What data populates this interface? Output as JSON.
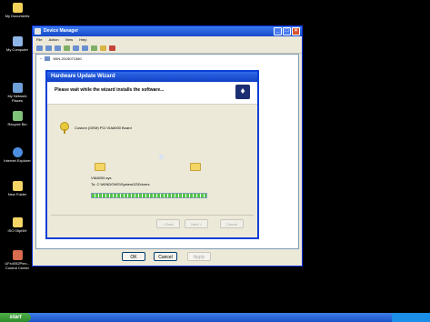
{
  "desktop": {
    "icons": [
      {
        "label": "My Documents",
        "icon": "my-documents-icon",
        "top": 0,
        "color": "#f2d25b"
      },
      {
        "label": "My Computer",
        "icon": "my-computer-icon",
        "top": 0,
        "color": "#8fb4e6"
      },
      {
        "label": "My Network Places",
        "icon": "network-places-icon",
        "top": 0,
        "color": "#6fa0d8"
      },
      {
        "label": "Recycle Bin",
        "icon": "recycle-bin-icon",
        "top": 0,
        "color": "#7fc37a"
      },
      {
        "label": "Internet Explorer",
        "icon": "internet-explorer-icon",
        "top": 0,
        "color": "#4d8fe0"
      },
      {
        "label": "New Folder",
        "icon": "folder-icon",
        "top": 0,
        "color": "#f4d565"
      },
      {
        "label": "ISO 05pf4H",
        "icon": "folder-icon",
        "top": 0,
        "color": "#f4d565"
      },
      {
        "label": "UFx4052Plex... Control Center",
        "icon": "control-center-icon",
        "top": 0,
        "color": "#d96b4f"
      }
    ]
  },
  "device_manager": {
    "title": "Device Manager",
    "menu": [
      "File",
      "Action",
      "View",
      "Help"
    ],
    "tree_root": "WIN-2015071360",
    "buttons": {
      "ok": "OK",
      "cancel": "Cancel",
      "apply": "Apply"
    }
  },
  "wizard": {
    "title": "Hardware Update Wizard",
    "message": "Please wait while the wizard installs the software...",
    "device_name": "Custom (OEM) PCI VIA6000 Board",
    "file_name": "VIA6000.sys",
    "destination": "To: C:\\WINDOWS\\System32\\Drivers",
    "progress_fraction": 1.0,
    "buttons": {
      "back": "< Back",
      "next": "Next >",
      "cancel": "Cancel"
    }
  },
  "taskbar": {
    "start_label": "start"
  }
}
